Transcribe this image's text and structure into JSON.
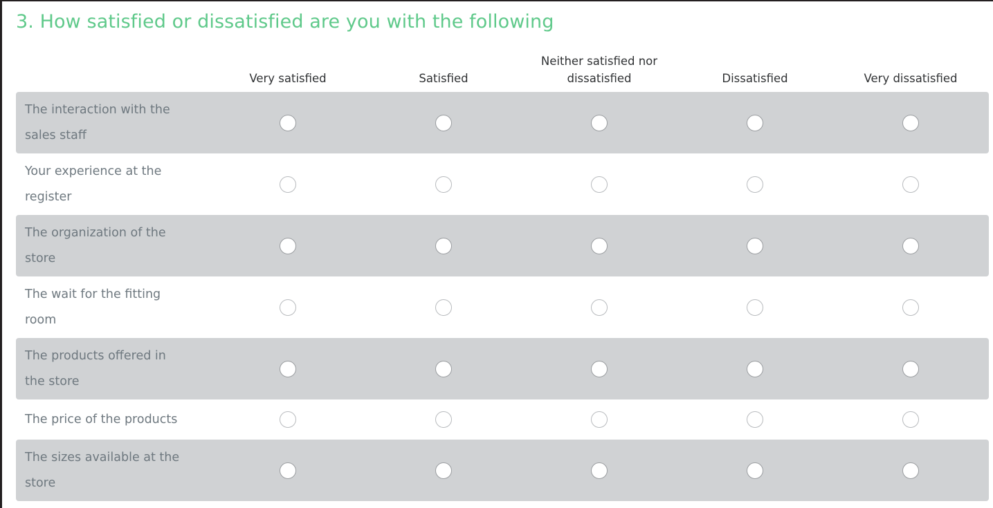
{
  "question": {
    "number": "3.",
    "title": "3. How satisfied or dissatisfied are you with the following",
    "title_color": "#5fc98a"
  },
  "matrix": {
    "columns": [
      {
        "label": "Very satisfied",
        "lines": [
          "Very satisfied"
        ]
      },
      {
        "label": "Satisfied",
        "lines": [
          "Satisfied"
        ]
      },
      {
        "label": "Neither satisfied nor dissatisfied",
        "lines": [
          "Neither satisfied nor",
          "dissatisfied"
        ]
      },
      {
        "label": "Dissatisfied",
        "lines": [
          "Dissatisfied"
        ]
      },
      {
        "label": "Very dissatisfied",
        "lines": [
          "Very dissatisfied"
        ]
      }
    ],
    "rows": [
      {
        "label": "The interaction with the sales staff",
        "lines": [
          "The interaction with the",
          "sales staff"
        ],
        "shaded": true,
        "selected": null
      },
      {
        "label": "Your experience at the register",
        "lines": [
          "Your experience at the",
          "register"
        ],
        "shaded": false,
        "selected": null
      },
      {
        "label": "The organization of the store",
        "lines": [
          "The organization of the",
          "store"
        ],
        "shaded": true,
        "selected": null
      },
      {
        "label": "The wait for the fitting room",
        "lines": [
          "The wait for the fitting",
          "room"
        ],
        "shaded": false,
        "selected": null
      },
      {
        "label": "The products offered in the store",
        "lines": [
          "The products offered in",
          "the store"
        ],
        "shaded": true,
        "selected": null
      },
      {
        "label": "The price of the products",
        "lines": [
          "The price of the products"
        ],
        "shaded": false,
        "selected": null
      },
      {
        "label": "The sizes available at the store",
        "lines": [
          "The sizes available at the",
          "store"
        ],
        "shaded": true,
        "selected": null
      }
    ],
    "shaded_row_color": "#d0d2d4",
    "plain_row_color": "#ffffff",
    "label_color": "#6e787f",
    "header_color": "#2f3133",
    "radio_border_color": "#9a9da0"
  }
}
